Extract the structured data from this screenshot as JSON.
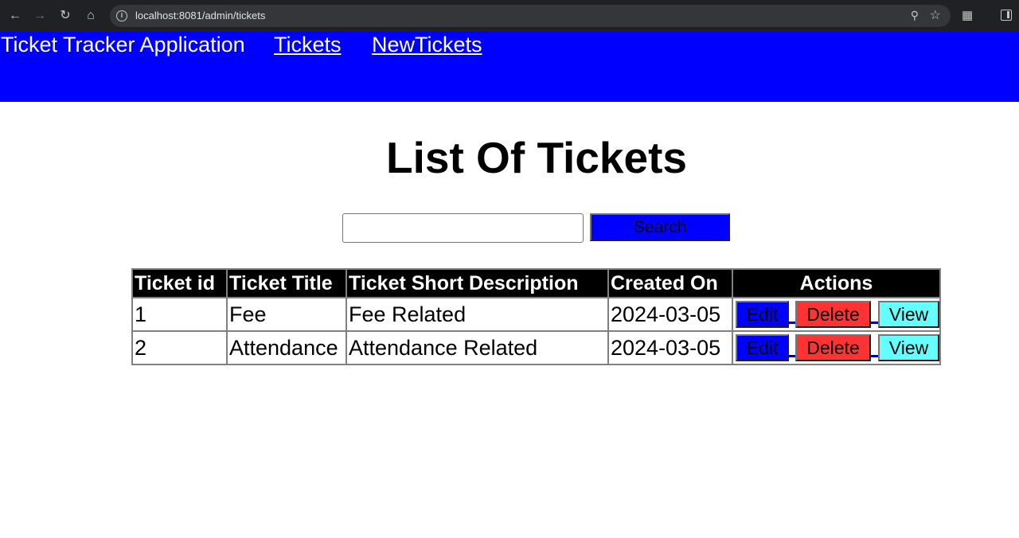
{
  "browser": {
    "url": "localhost:8081/admin/tickets"
  },
  "header": {
    "brand": "Ticket Tracker Application",
    "nav": [
      {
        "label": "Tickets"
      },
      {
        "label": "NewTickets"
      }
    ]
  },
  "main": {
    "title": "List Of Tickets",
    "search": {
      "value": "",
      "button_label": "Search"
    },
    "table": {
      "columns": [
        "Ticket id",
        "Ticket Title",
        "Ticket Short Description",
        "Created On",
        "Actions"
      ],
      "rows": [
        {
          "id": "1",
          "title": "Fee",
          "description": "Fee Related",
          "created": "2024-03-05"
        },
        {
          "id": "2",
          "title": "Attendance",
          "description": "Attendance Related",
          "created": "2024-03-05"
        }
      ],
      "actions": {
        "edit": "Edit",
        "delete": "Delete",
        "view": "View"
      }
    }
  },
  "colors": {
    "header_bg": "#0000ff",
    "edit_bg": "#0000ff",
    "delete_bg": "#ff3333",
    "view_bg": "#66ffff"
  }
}
